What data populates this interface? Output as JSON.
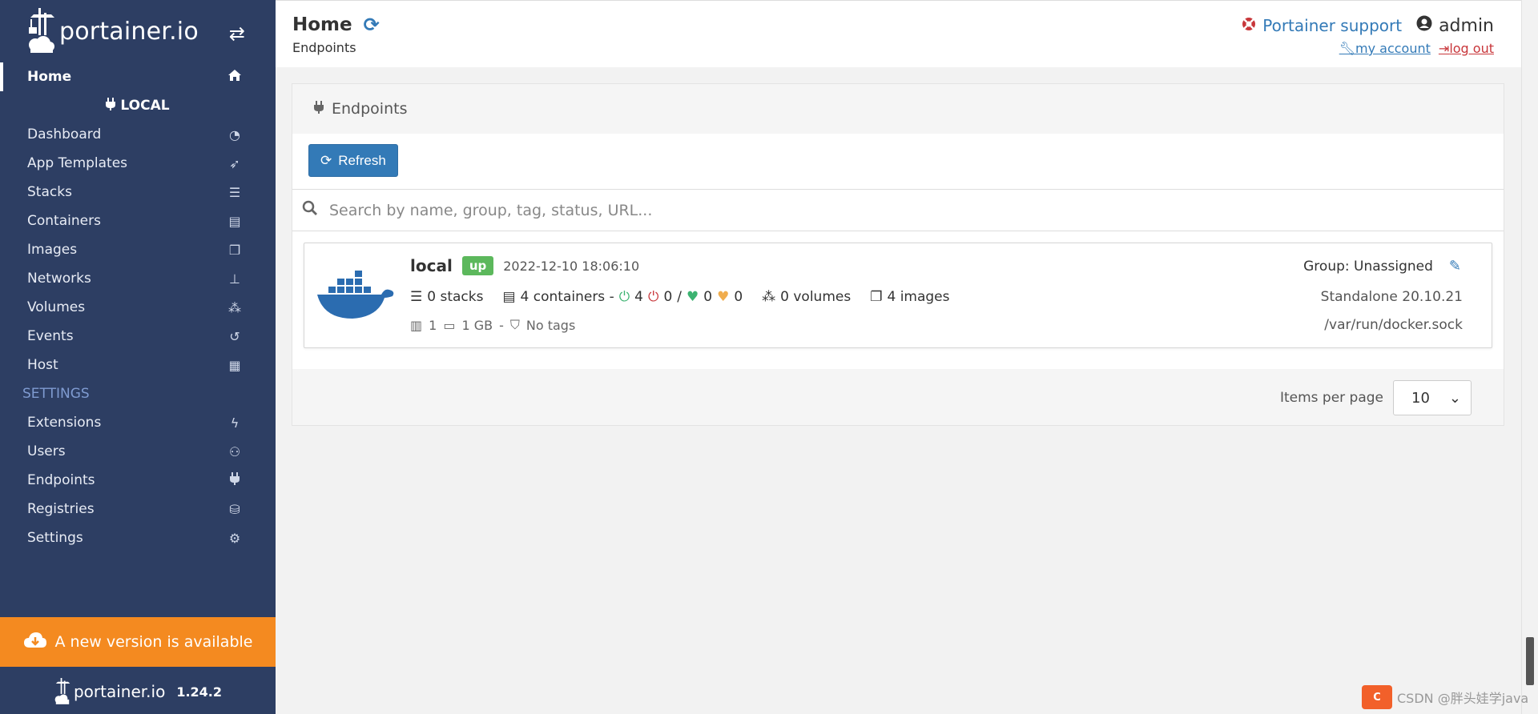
{
  "brand": {
    "name": "portainer.io",
    "toggle_icon": "exchange-arrows-icon"
  },
  "sidebar": {
    "home_label": "Home",
    "endpoint_heading": "LOCAL",
    "items": [
      {
        "label": "Dashboard",
        "icon": "tachometer-icon"
      },
      {
        "label": "App Templates",
        "icon": "rocket-icon"
      },
      {
        "label": "Stacks",
        "icon": "th-list-icon"
      },
      {
        "label": "Containers",
        "icon": "server-icon"
      },
      {
        "label": "Images",
        "icon": "clone-icon"
      },
      {
        "label": "Networks",
        "icon": "sitemap-icon"
      },
      {
        "label": "Volumes",
        "icon": "cubes-icon"
      },
      {
        "label": "Events",
        "icon": "history-icon"
      },
      {
        "label": "Host",
        "icon": "th-icon"
      }
    ],
    "settings_heading": "SETTINGS",
    "settings_items": [
      {
        "label": "Extensions",
        "icon": "bolt-icon"
      },
      {
        "label": "Users",
        "icon": "users-icon"
      },
      {
        "label": "Endpoints",
        "icon": "plug-icon"
      },
      {
        "label": "Registries",
        "icon": "database-icon"
      },
      {
        "label": "Settings",
        "icon": "cogs-icon"
      }
    ],
    "update_banner": "A new version is available",
    "footer_brand": "portainer.io",
    "footer_version": "1.24.2"
  },
  "header": {
    "title": "Home",
    "breadcrumb": "Endpoints",
    "support_label": "Portainer support",
    "username": "admin",
    "my_account": "my account",
    "log_out": "log out"
  },
  "endpoints_widget": {
    "title": "Endpoints",
    "refresh_label": "Refresh",
    "search_placeholder": "Search by name, group, tag, status, URL...",
    "items_per_page_label": "Items per page",
    "items_per_page": "10"
  },
  "endpoint": {
    "name": "local",
    "status": "up",
    "timestamp": "2022-12-10 18:06:10",
    "stacks": "0 stacks",
    "containers": "4 containers -",
    "running": "4",
    "stopped": "0",
    "separator": "/",
    "healthy": "0",
    "unhealthy": "0",
    "volumes": "0 volumes",
    "images": "4 images",
    "cpu": "1",
    "memory": "1 GB",
    "dash": "-",
    "tags": "No tags",
    "group": "Group: Unassigned",
    "type_version": "Standalone 20.10.21",
    "url": "/var/run/docker.sock"
  },
  "watermark": {
    "badge": "C",
    "text": "CSDN @胖头娃学java"
  },
  "colors": {
    "sidebar_bg": "#2d3e63",
    "accent": "#337ab7",
    "update_banner": "#f48a20",
    "status_up": "#5cb85c",
    "danger": "#c8363a"
  }
}
